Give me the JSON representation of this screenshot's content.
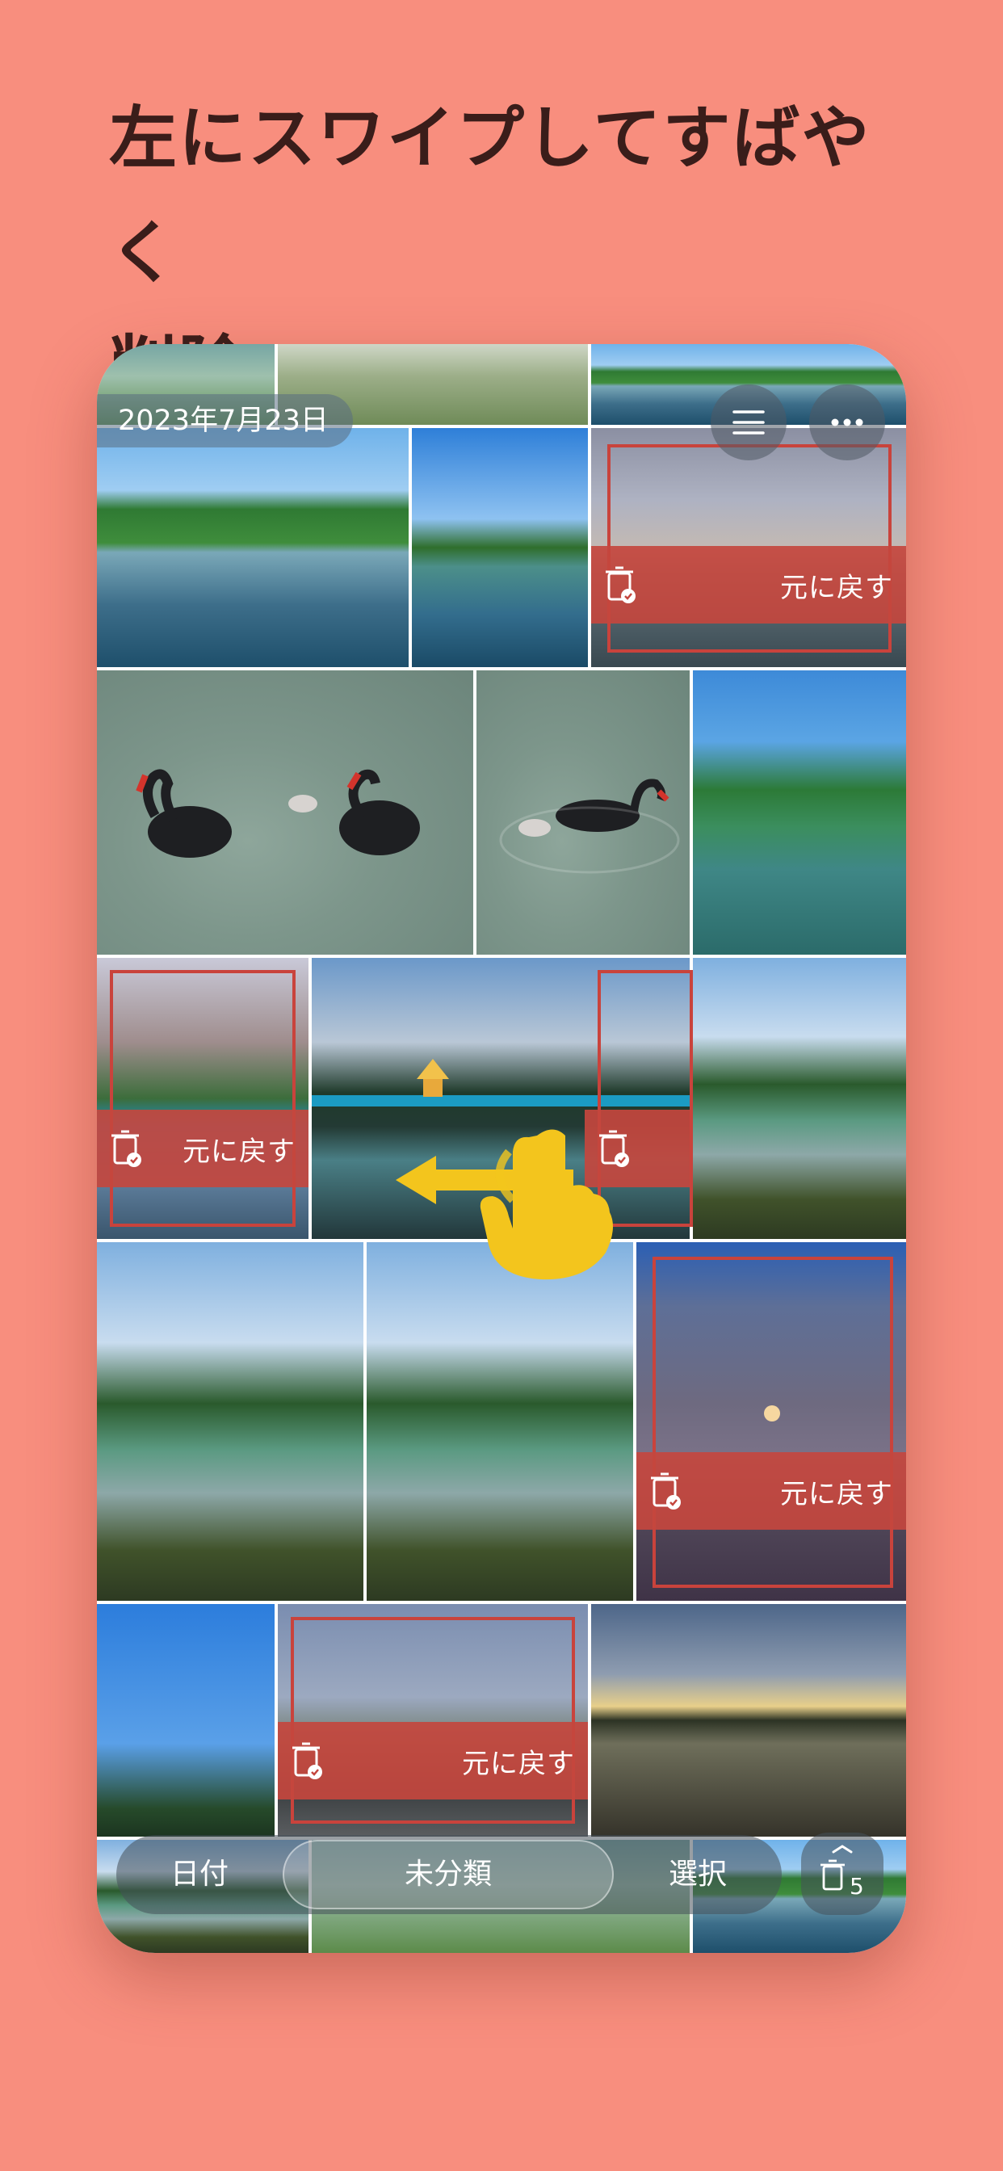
{
  "headline": {
    "line1": "左にスワイプしてすばやく",
    "line2": "削除"
  },
  "gallery": {
    "date_label": "2023年7月23日",
    "undo_label": "元に戻す",
    "menu_icon": "list-icon",
    "more_icon": "ellipsis-icon"
  },
  "bottom_bar": {
    "date_tab": "日付",
    "uncategorized_tab": "未分類",
    "select_tab": "選択",
    "trash_count": "5"
  },
  "colors": {
    "background": "#f88e7e",
    "delete_red": "#c9433c",
    "gesture_yellow": "#f3c51d"
  }
}
